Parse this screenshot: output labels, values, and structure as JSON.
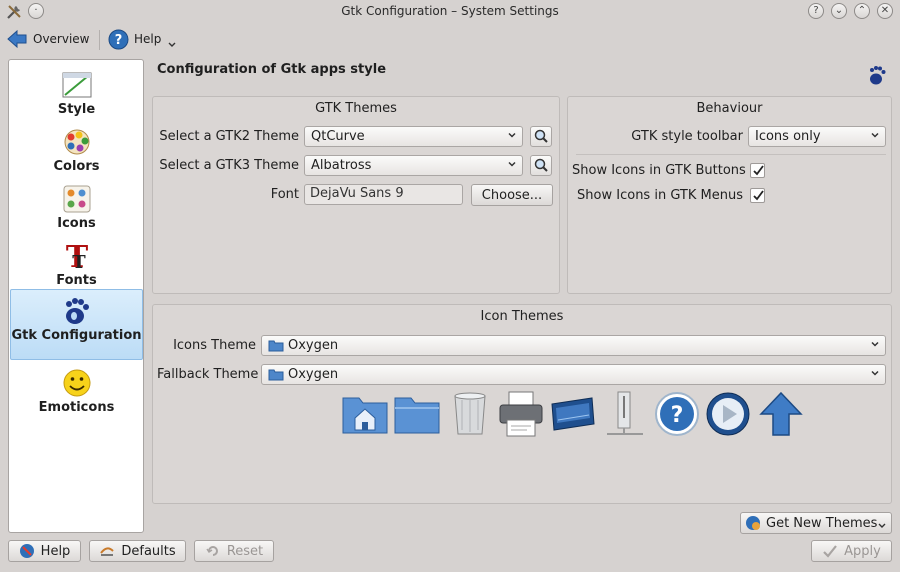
{
  "window": {
    "title": "Gtk Configuration – System Settings",
    "controls": {
      "help": "?",
      "minimize": "⌄",
      "maximize": "⌃",
      "close": "✕"
    }
  },
  "toolbar": {
    "overview_label": "Overview",
    "help_label": "Help"
  },
  "sidebar": {
    "items": [
      {
        "label": "Style",
        "icon": "style-icon"
      },
      {
        "label": "Colors",
        "icon": "colors-icon"
      },
      {
        "label": "Icons",
        "icon": "icons-icon"
      },
      {
        "label": "Fonts",
        "icon": "fonts-icon"
      },
      {
        "label": "Gtk Configuration",
        "icon": "gnome-foot-icon",
        "active": true
      },
      {
        "label": "Emoticons",
        "icon": "emoticon-icon"
      }
    ]
  },
  "main": {
    "heading": "Configuration of Gtk apps style",
    "gtk_themes": {
      "title": "GTK Themes",
      "gtk2_label": "Select a GTK2 Theme",
      "gtk2_value": "QtCurve",
      "gtk3_label": "Select a GTK3 Theme",
      "gtk3_value": "Albatross",
      "font_label": "Font",
      "font_value": "DejaVu Sans 9",
      "choose_label": "Choose..."
    },
    "behaviour": {
      "title": "Behaviour",
      "toolbar_label": "GTK style toolbar",
      "toolbar_value": "Icons only",
      "show_icons_buttons_label": "Show Icons in GTK Buttons",
      "show_icons_buttons_checked": true,
      "show_icons_menus_label": "Show Icons in GTK Menus",
      "show_icons_menus_checked": true
    },
    "icon_themes": {
      "title": "Icon Themes",
      "icons_theme_label": "Icons Theme",
      "icons_theme_value": "Oxygen",
      "fallback_theme_label": "Fallback Theme",
      "fallback_theme_value": "Oxygen",
      "preview_icons": [
        "home-folder-icon",
        "folder-icon",
        "trash-icon",
        "printer-icon",
        "scanner-icon",
        "computer-tower-icon",
        "help-icon",
        "media-play-icon",
        "up-arrow-icon"
      ]
    },
    "get_new_themes_label": "Get New Themes"
  },
  "footer": {
    "help_label": "Help",
    "defaults_label": "Defaults",
    "reset_label": "Reset",
    "apply_label": "Apply"
  },
  "colors": {
    "active_bg": "#bcdcf6",
    "window_bg": "#d6d2d0",
    "accent_blue": "#2f6fb8"
  }
}
